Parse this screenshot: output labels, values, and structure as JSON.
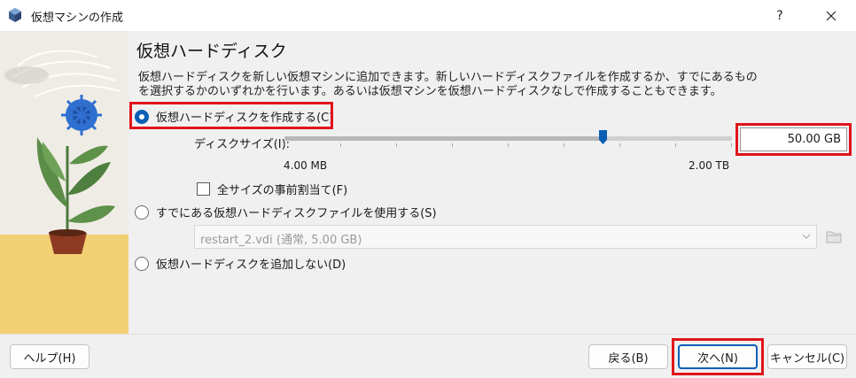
{
  "window": {
    "title": "仮想マシンの作成",
    "help_label": "?"
  },
  "page": {
    "title": "仮想ハードディスク",
    "description": "仮想ハードディスクを新しい仮想マシンに追加できます。新しいハードディスクファイルを作成するか、すでにあるものを選択するかのいずれかを行います。あるいは仮想マシンを仮想ハードディスクなしで作成することもできます。"
  },
  "options": {
    "create_new": {
      "label": "仮想ハードディスクを作成する(C)",
      "selected": true
    },
    "use_existing": {
      "label": "すでにある仮想ハードディスクファイルを使用する(S)",
      "selected": false
    },
    "no_disk": {
      "label": "仮想ハードディスクを追加しない(D)",
      "selected": false
    }
  },
  "disk_size": {
    "label": "ディスクサイズ(I):",
    "value": "50.00 GB",
    "min_label": "4.00 MB",
    "max_label": "2.00 TB",
    "slider_fraction": 0.72
  },
  "preallocate": {
    "label": "全サイズの事前割当て(F)",
    "checked": false
  },
  "existing_file": {
    "selected": "restart_2.vdi (通常, 5.00 GB)"
  },
  "buttons": {
    "help": "ヘルプ(H)",
    "back": "戻る(B)",
    "next": "次へ(N)",
    "cancel": "キャンセル(C)"
  },
  "colors": {
    "accent": "#0a5fb5",
    "highlight_box": "#e0141b"
  },
  "icons": {
    "app": "virtualbox-icon",
    "close": "close-icon",
    "folder": "folder-icon",
    "dropdown": "chevron-down-icon"
  }
}
